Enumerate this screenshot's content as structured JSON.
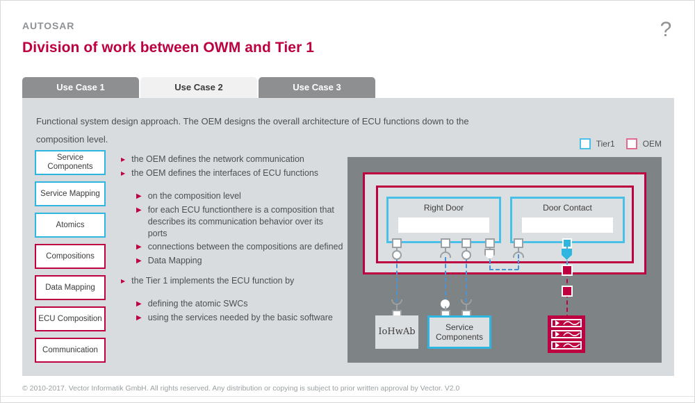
{
  "header": {
    "eyebrow": "AUTOSAR",
    "title": "Division of work between OWM and Tier 1",
    "help_label": "?"
  },
  "tabs": [
    {
      "label": "Use Case 1",
      "active": false
    },
    {
      "label": "Use Case 2",
      "active": true
    },
    {
      "label": "Use Case 3",
      "active": false
    }
  ],
  "panel": {
    "description": "Functional system design approach. The OEM designs the overall architecture of ECU functions down to the composition level."
  },
  "legend": [
    {
      "label": "Tier1",
      "color": "#49c0e8"
    },
    {
      "label": "OEM",
      "color": "#e06b8e"
    }
  ],
  "artifact_boxes": [
    {
      "label": "Service Components",
      "owner": "Tier1",
      "color": "#2fb6e0"
    },
    {
      "label": "Service Mapping",
      "owner": "Tier1",
      "color": "#2fb6e0"
    },
    {
      "label": "Atomics",
      "owner": "Tier1",
      "color": "#2fb6e0"
    },
    {
      "label": "Compositions",
      "owner": "OEM",
      "color": "#bd0040"
    },
    {
      "label": "Data Mapping",
      "owner": "OEM",
      "color": "#bd0040"
    },
    {
      "label": "ECU Composition",
      "owner": "OEM",
      "color": "#bd0040"
    },
    {
      "label": "Communication",
      "owner": "OEM",
      "color": "#bd0040"
    }
  ],
  "bullets": [
    {
      "level": 1,
      "text": "the OEM defines the network communication"
    },
    {
      "level": 1,
      "text": "the OEM defines the interfaces of ECU functions"
    },
    {
      "level": 2,
      "text": "on the composition level"
    },
    {
      "level": 2,
      "text": "for each ECU functionthere is a composition that describes its communication behavior over its ports"
    },
    {
      "level": 2,
      "text": "connections between the compositions are defined"
    },
    {
      "level": 2,
      "text": "Data Mapping"
    },
    {
      "level": 1,
      "text": "the Tier 1 implements the ECU function by"
    },
    {
      "level": 2,
      "text": "defining the atomic SWCs"
    },
    {
      "level": 2,
      "text": "using the services needed by the basic software"
    }
  ],
  "diagram": {
    "compositions": [
      {
        "title": "Right Door"
      },
      {
        "title": "Door Contact"
      }
    ],
    "bottom_blocks": [
      {
        "label": "IoHwAb",
        "style": "plain"
      },
      {
        "label": "Service Components",
        "style": "cyan"
      }
    ],
    "service_icon_rows": 3,
    "colors": {
      "oem_border": "#bd0040",
      "tier_border": "#2fb6e0",
      "connector": "#4a93d4",
      "backdrop": "#7e8385",
      "surface": "#dcdfe1"
    }
  },
  "footer": {
    "text": "© 2010-2017. Vector Informatik GmbH. All rights reserved. Any distribution or copying is subject to prior written approval by Vector. V2.0"
  }
}
